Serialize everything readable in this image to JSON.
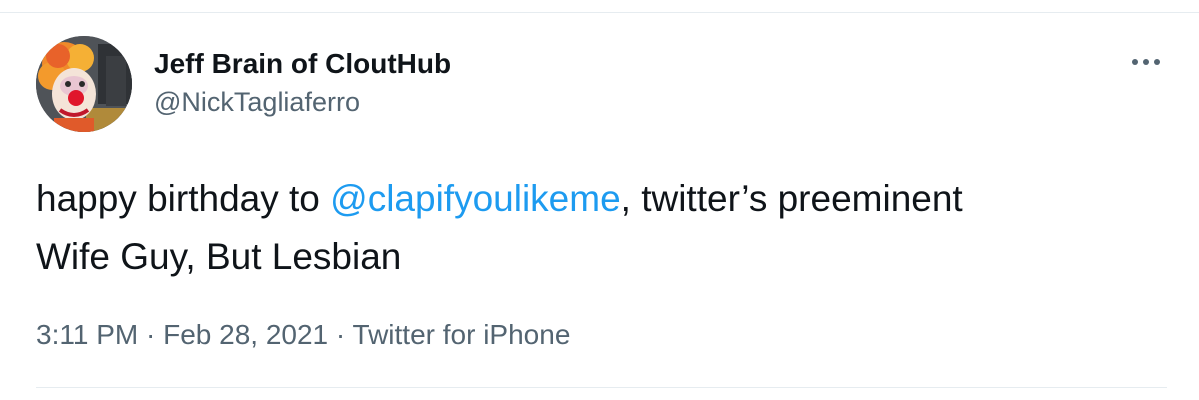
{
  "author": {
    "display_name": "Jeff Brain of CloutHub",
    "handle": "@NickTagliaferro"
  },
  "tweet": {
    "text_before": "happy birthday to ",
    "mention": "@clapifyoulikeme",
    "text_after_line1": ", twitter’s preeminent",
    "text_line2": "Wife Guy, But Lesbian"
  },
  "meta": {
    "time": "3:11 PM",
    "separator1": " · ",
    "date": "Feb 28, 2021",
    "separator2": " · ",
    "source": "Twitter for iPhone"
  },
  "icons": {
    "more": "more-dots-icon"
  },
  "colors": {
    "text": "#0f1419",
    "secondary": "#536471",
    "link": "#1d9bf0",
    "border": "#e6ecf0"
  }
}
